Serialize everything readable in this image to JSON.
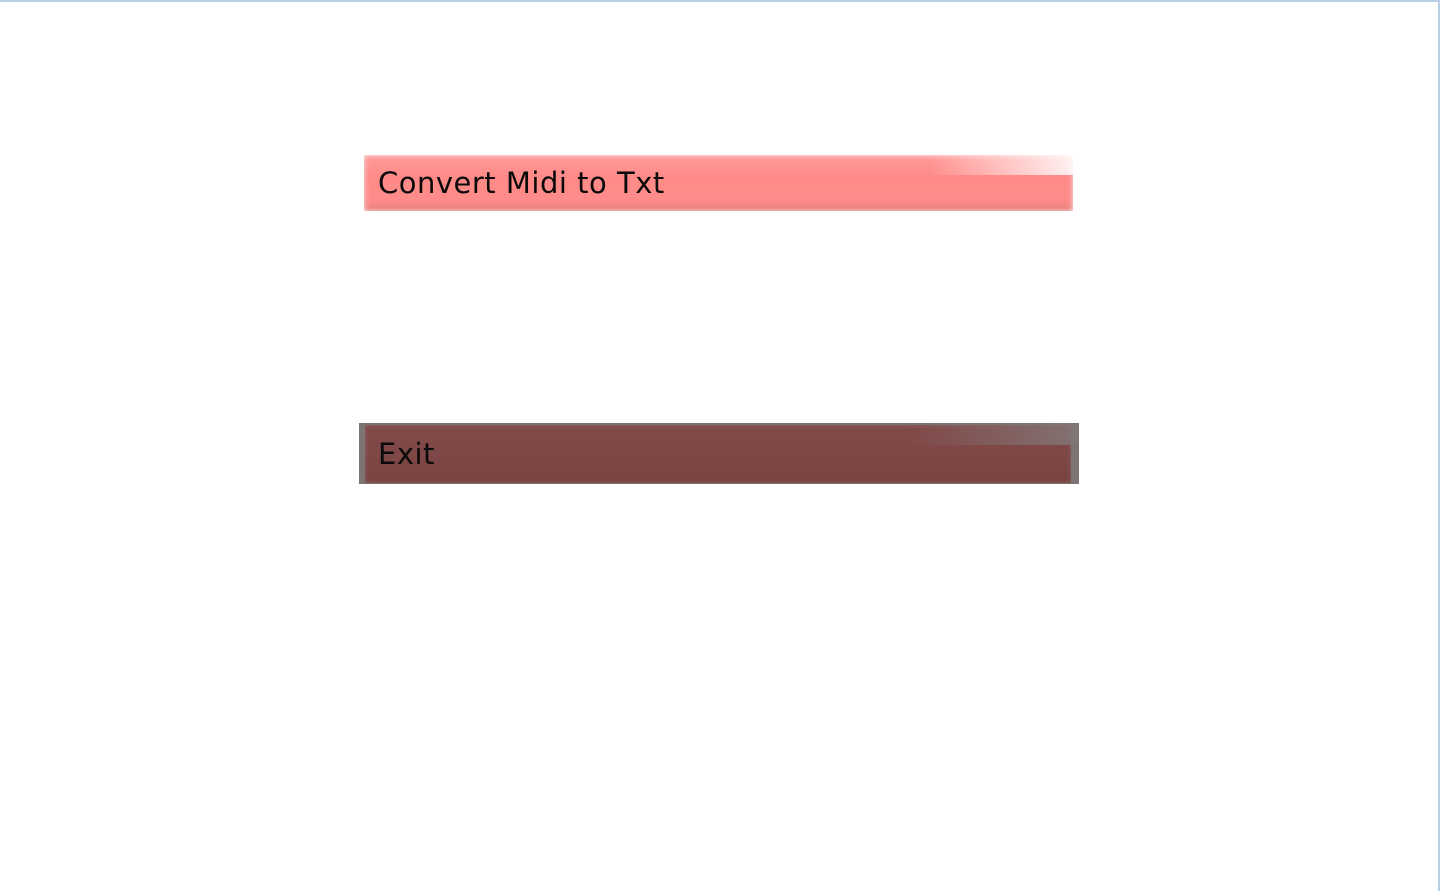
{
  "menu": {
    "buttons": [
      {
        "label": "Convert Midi to Txt",
        "color": "#ff8a88"
      },
      {
        "label": "Exit",
        "color": "#7e4846"
      }
    ]
  }
}
